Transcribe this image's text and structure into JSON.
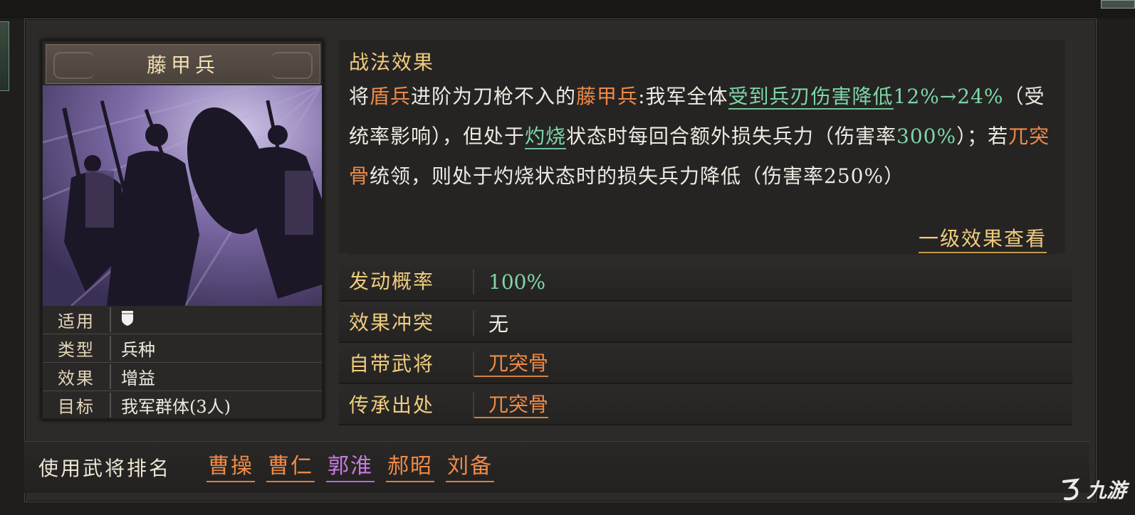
{
  "card": {
    "title": "藤甲兵",
    "rows": [
      {
        "label": "适用",
        "value": ""
      },
      {
        "label": "类型",
        "value": "兵种"
      },
      {
        "label": "效果",
        "value": "增益"
      },
      {
        "label": "目标",
        "value": "我军群体(3人)"
      }
    ],
    "applicable_icon": "shield-icon"
  },
  "description": {
    "heading": "战法效果",
    "segments": [
      {
        "text": "将",
        "style": "normal"
      },
      {
        "text": "盾兵",
        "style": "orange"
      },
      {
        "text": "进阶为刀枪不入的",
        "style": "normal"
      },
      {
        "text": "藤甲兵",
        "style": "orange"
      },
      {
        "text": ":我军全体",
        "style": "normal"
      },
      {
        "text": "受到兵刃伤害降低",
        "style": "green-underline"
      },
      {
        "text": "12%→24%",
        "style": "green"
      },
      {
        "text": "（受统率影响），但处于",
        "style": "normal"
      },
      {
        "text": "灼烧",
        "style": "green-underline"
      },
      {
        "text": "状态时每回合额外损失兵力（伤害率",
        "style": "normal"
      },
      {
        "text": "300%",
        "style": "green"
      },
      {
        "text": "）；若",
        "style": "normal"
      },
      {
        "text": "兀突骨",
        "style": "orange"
      },
      {
        "text": "统领，则处于灼烧状态时的损失兵力降低（伤害率250%）",
        "style": "normal"
      }
    ],
    "view_level1": "一级效果查看"
  },
  "info": {
    "trigger_rate_label": "发动概率",
    "trigger_rate_value": "100%",
    "conflict_label": "效果冲突",
    "conflict_value": "无",
    "own_general_label": "自带武将",
    "own_general_value": "兀突骨",
    "inherit_label": "传承出处",
    "inherit_value": "兀突骨"
  },
  "footer": {
    "label": "使用武将排名",
    "generals": [
      {
        "name": "曹操",
        "color": "orange"
      },
      {
        "name": "曹仁",
        "color": "orange"
      },
      {
        "name": "郭淮",
        "color": "purple"
      },
      {
        "name": "郝昭",
        "color": "orange"
      },
      {
        "name": "刘备",
        "color": "orange"
      }
    ]
  },
  "watermark": "九游",
  "colors": {
    "gold": "#f0cc7e",
    "orange": "#ee8a47",
    "green": "#7fd6a8",
    "purple": "#c67ae2"
  }
}
